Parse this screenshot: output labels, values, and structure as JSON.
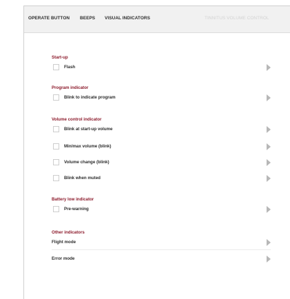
{
  "tabs": [
    {
      "label": "OPERATE BUTTON",
      "enabled": true
    },
    {
      "label": "BEEPS",
      "enabled": true
    },
    {
      "label": "VISUAL INDICATORS",
      "enabled": true,
      "active": true
    },
    {
      "label": "TINNITUS VOLUME CONTROL",
      "enabled": false
    }
  ],
  "sections": {
    "startup": {
      "title": "Start-up",
      "flash": {
        "label": "Flash",
        "checked": false
      }
    },
    "program_indicator": {
      "title": "Program indicator",
      "blink": {
        "label": "Blink to indicate program",
        "checked": false
      }
    },
    "volume_control": {
      "title": "Volume control indicator",
      "items": [
        {
          "label": "Blink at start-up volume",
          "checked": false
        },
        {
          "label": "Min/max volume (blink)",
          "checked": false
        },
        {
          "label": "Volume change (blink)",
          "checked": false
        },
        {
          "label": "Blink when muted",
          "checked": false
        }
      ]
    },
    "battery": {
      "title": "Battery low indicator",
      "prewarning": {
        "label": "Pre-warning",
        "checked": false
      }
    },
    "other": {
      "title": "Other indicators",
      "items": [
        {
          "label": "Flight mode"
        },
        {
          "label": "Error mode"
        }
      ]
    }
  },
  "colors": {
    "section_title": "#8c1a2b",
    "arrow": "#b7b7b7",
    "tab_bar": "#f1f1f1",
    "disabled_tab": "#d2d2d2"
  },
  "icons": {
    "row_expand": "chevron-right-icon",
    "checkbox": "checkbox-unchecked"
  }
}
